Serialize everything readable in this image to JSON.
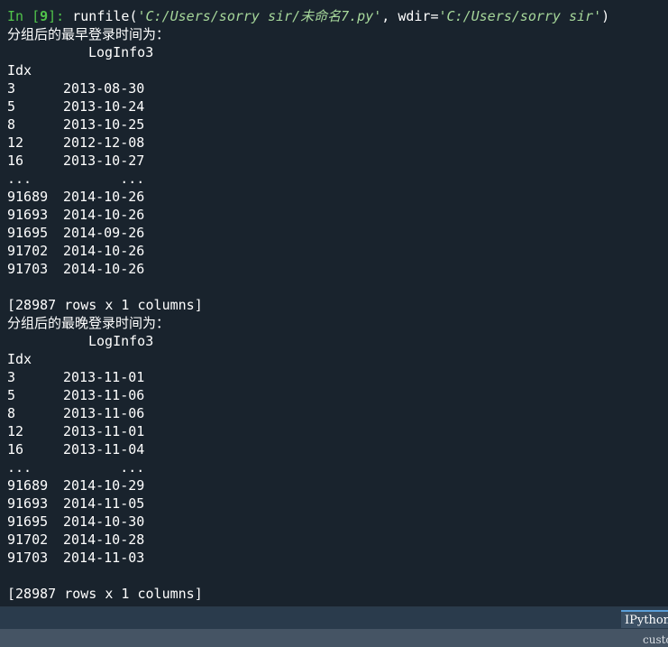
{
  "console": {
    "prompt_label": "In [",
    "prompt_number": "9",
    "prompt_suffix": "]: ",
    "command_func": "runfile(",
    "command_arg1": "'C:/Users/sorry sir/未命名7.py'",
    "command_sep": ", wdir=",
    "command_arg2": "'C:/Users/sorry sir'",
    "command_close": ")",
    "earliest": {
      "heading": "分组后的最早登录时间为：",
      "column": "LogInfo3",
      "index_name": "Idx",
      "rows": [
        {
          "idx": "3",
          "val": "2013-08-30"
        },
        {
          "idx": "5",
          "val": "2013-10-24"
        },
        {
          "idx": "8",
          "val": "2013-10-25"
        },
        {
          "idx": "12",
          "val": "2012-12-08"
        },
        {
          "idx": "16",
          "val": "2013-10-27"
        },
        {
          "idx": "...",
          "val": "       ..."
        },
        {
          "idx": "91689",
          "val": "2014-10-26"
        },
        {
          "idx": "91693",
          "val": "2014-10-26"
        },
        {
          "idx": "91695",
          "val": "2014-09-26"
        },
        {
          "idx": "91702",
          "val": "2014-10-26"
        },
        {
          "idx": "91703",
          "val": "2014-10-26"
        }
      ],
      "footer": "[28987 rows x 1 columns]"
    },
    "latest": {
      "heading": "分组后的最晚登录时间为：",
      "column": "LogInfo3",
      "index_name": "Idx",
      "rows": [
        {
          "idx": "3",
          "val": "2013-11-01"
        },
        {
          "idx": "5",
          "val": "2013-11-06"
        },
        {
          "idx": "8",
          "val": "2013-11-06"
        },
        {
          "idx": "12",
          "val": "2013-11-01"
        },
        {
          "idx": "16",
          "val": "2013-11-04"
        },
        {
          "idx": "...",
          "val": "       ..."
        },
        {
          "idx": "91689",
          "val": "2014-10-29"
        },
        {
          "idx": "91693",
          "val": "2014-11-05"
        },
        {
          "idx": "91695",
          "val": "2014-10-30"
        },
        {
          "idx": "91702",
          "val": "2014-10-28"
        },
        {
          "idx": "91703",
          "val": "2014-11-03"
        }
      ],
      "footer": "[28987 rows x 1 columns]"
    }
  },
  "tabs": {
    "ipython_label": "IPython console"
  },
  "statusbar": {
    "right_text": "custom"
  },
  "colors": {
    "background": "#19232d",
    "prompt": "#51c44b",
    "string": "#a6d79a",
    "text": "#ffffff"
  }
}
